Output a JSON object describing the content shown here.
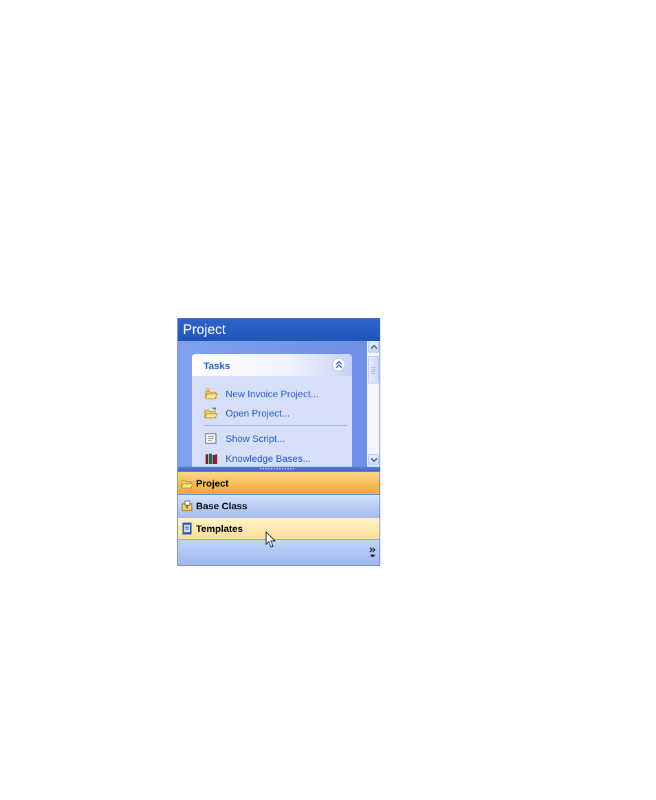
{
  "panel": {
    "title": "Project"
  },
  "tasks_card": {
    "title": "Tasks",
    "collapse_icon": "double-chevron-up-icon",
    "items": [
      {
        "label": "New Invoice Project...",
        "icon": "new-project-icon"
      },
      {
        "label": "Open Project...",
        "icon": "open-folder-icon"
      },
      {
        "label": "Show Script...",
        "icon": "script-icon"
      },
      {
        "label": "Knowledge Bases...",
        "icon": "books-icon"
      }
    ]
  },
  "nav_buttons": [
    {
      "label": "Project",
      "icon": "project-folder-icon",
      "state": "selected"
    },
    {
      "label": "Base Class",
      "icon": "base-class-icon",
      "state": "normal"
    },
    {
      "label": "Templates",
      "icon": "templates-icon",
      "state": "hover"
    }
  ],
  "footer": {
    "icon": "more-chevron-icon"
  },
  "colors": {
    "header": "#2f63c9",
    "selected_nav": "#f0a933",
    "hover_nav": "#fcdf96",
    "link_text": "#215dc6"
  }
}
